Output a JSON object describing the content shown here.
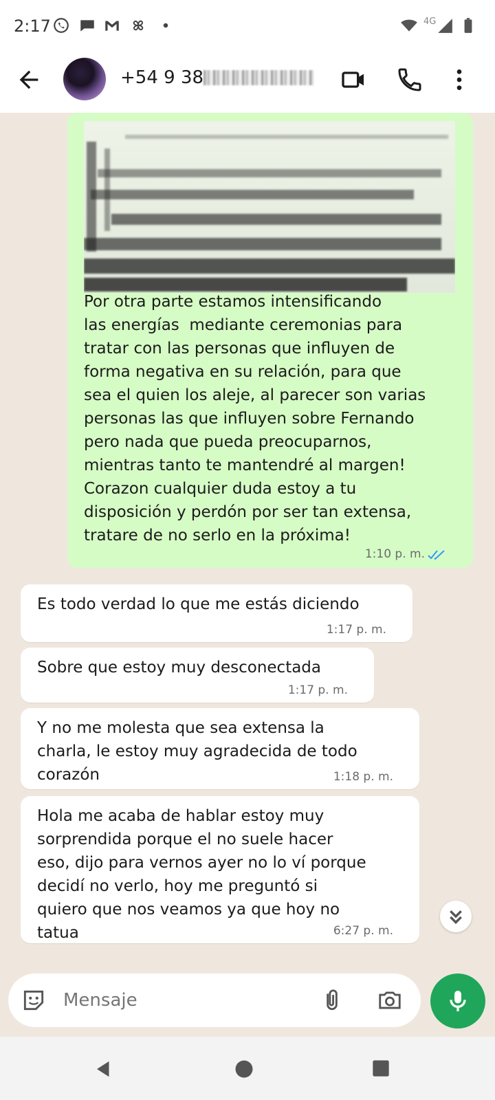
{
  "status_bar": {
    "time": "2:17",
    "network_label": "4G",
    "icons": [
      "whatsapp-icon",
      "chat-bubble-icon",
      "gmail-icon",
      "pinwheel-icon",
      "dot-icon",
      "wifi-icon",
      "signal-icon",
      "battery-icon"
    ]
  },
  "header": {
    "contact_number": "+54 9 38",
    "icons": [
      "back-arrow-icon",
      "video-call-icon",
      "phone-icon",
      "more-vert-icon"
    ]
  },
  "messages": [
    {
      "direction": "outgoing",
      "has_image": true,
      "text": "Por otra parte estamos intensificando\nlas energías  mediante ceremonias para\ntratar con las personas que influyen de\nforma negativa en su relación, para que\nsea el quien los aleje, al parecer son varias\npersonas las que influyen sobre Fernando\npero nada que pueda preocuparnos,\nmientras tanto te mantendré al margen!\nCorazon cualquier duda estoy a tu\ndisposición y perdón por ser tan extensa,\ntratare de no serlo en la próxima!",
      "time": "1:10 p. m.",
      "status": "read"
    },
    {
      "direction": "incoming",
      "text": "Es todo verdad lo que me estás diciendo",
      "time": "1:17 p. m."
    },
    {
      "direction": "incoming",
      "text": "Sobre que estoy muy desconectada",
      "time": "1:17 p. m."
    },
    {
      "direction": "incoming",
      "text": "Y no me molesta que sea extensa la\ncharla, le estoy muy agradecida de todo\ncorazón",
      "time": "1:18 p. m."
    },
    {
      "direction": "incoming",
      "text": "Hola me acaba de hablar estoy muy\nsorprendida porque el no suele hacer\neso, dijo para vernos ayer no lo ví porque\ndecidí no verlo, hoy me preguntó si\nquiero que nos veamos ya que hoy no\ntatua",
      "time": "6:27 p. m."
    }
  ],
  "composer": {
    "placeholder": "Mensaje",
    "icons": [
      "sticker-icon",
      "attach-icon",
      "camera-icon",
      "mic-icon"
    ]
  },
  "colors": {
    "outgoing_bubble": "#d6fcc6",
    "incoming_bubble": "#ffffff",
    "chat_background": "#efe7dd",
    "mic_button": "#1fa65a",
    "read_ticks": "#3497f9"
  }
}
